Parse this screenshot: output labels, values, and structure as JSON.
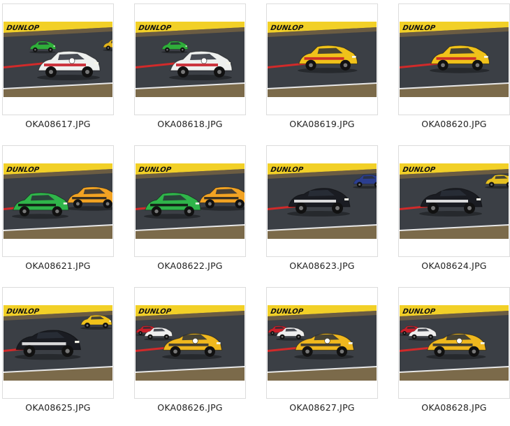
{
  "gallery": {
    "items": [
      {
        "filename": "OKA08617.JPG",
        "scene": "toyota-celica-white-red",
        "cars": [
          {
            "type": "rally",
            "color": "#eef0ee",
            "accent": "#c8202a"
          },
          {
            "type": "small",
            "color": "#2fae3a"
          },
          {
            "type": "small",
            "color": "#e0b21c"
          }
        ]
      },
      {
        "filename": "OKA08618.JPG",
        "scene": "toyota-celica-white-red",
        "cars": [
          {
            "type": "rally",
            "color": "#eef0ee",
            "accent": "#c8202a"
          },
          {
            "type": "small",
            "color": "#2fae3a"
          }
        ]
      },
      {
        "filename": "OKA08619.JPG",
        "scene": "yellow-hatchback",
        "cars": [
          {
            "type": "hatch",
            "color": "#f0c21a",
            "accent": "#c8202a"
          }
        ]
      },
      {
        "filename": "OKA08620.JPG",
        "scene": "yellow-hatchback",
        "cars": [
          {
            "type": "hatch",
            "color": "#f0c21a",
            "accent": "#c8202a"
          }
        ]
      },
      {
        "filename": "OKA08621.JPG",
        "scene": "green-and-orange",
        "cars": [
          {
            "type": "hatch",
            "color": "#2fb54a",
            "accent": "#111"
          },
          {
            "type": "hatch",
            "color": "#f2a323",
            "accent": "#222"
          }
        ]
      },
      {
        "filename": "OKA08622.JPG",
        "scene": "green-and-orange",
        "cars": [
          {
            "type": "hatch",
            "color": "#2fb54a",
            "accent": "#111"
          },
          {
            "type": "hatch",
            "color": "#f2a323",
            "accent": "#222"
          }
        ]
      },
      {
        "filename": "OKA08623.JPG",
        "scene": "black-gtr",
        "cars": [
          {
            "type": "coupe",
            "color": "#1a1c22",
            "accent": "#eeeeee"
          },
          {
            "type": "small",
            "color": "#2b3e8f"
          }
        ]
      },
      {
        "filename": "OKA08624.JPG",
        "scene": "black-gtr",
        "cars": [
          {
            "type": "coupe",
            "color": "#1a1c22",
            "accent": "#eeeeee"
          },
          {
            "type": "small",
            "color": "#e6c020"
          }
        ]
      },
      {
        "filename": "OKA08625.JPG",
        "scene": "black-gtr-yellow-porsche",
        "cars": [
          {
            "type": "coupe",
            "color": "#1a1c22",
            "accent": "#eeeeee"
          },
          {
            "type": "small",
            "color": "#f0c21a"
          }
        ]
      },
      {
        "filename": "OKA08626.JPG",
        "scene": "yellow-porsche",
        "cars": [
          {
            "type": "porsche",
            "color": "#f0b81e",
            "accent": "#333"
          },
          {
            "type": "small",
            "color": "#eeeeee"
          },
          {
            "type": "small",
            "color": "#c8202a"
          }
        ]
      },
      {
        "filename": "OKA08627.JPG",
        "scene": "yellow-porsche",
        "cars": [
          {
            "type": "porsche",
            "color": "#f0b81e",
            "accent": "#333"
          },
          {
            "type": "small",
            "color": "#eeeeee"
          },
          {
            "type": "small",
            "color": "#c8202a"
          }
        ]
      },
      {
        "filename": "OKA08628.JPG",
        "scene": "yellow-porsche",
        "cars": [
          {
            "type": "porsche",
            "color": "#f0b81e",
            "accent": "#333"
          },
          {
            "type": "small",
            "color": "#eeeeee"
          },
          {
            "type": "small",
            "color": "#c8202a"
          }
        ]
      }
    ],
    "billboard_text": "DUNLOP",
    "colors": {
      "billboard": "#f2d027",
      "asphalt": "#3b3f45",
      "grass": "#7b6a4a",
      "kerb_red": "#d12a2a",
      "caption_text": "#222222",
      "frame_border": "#dcdcdc"
    }
  }
}
